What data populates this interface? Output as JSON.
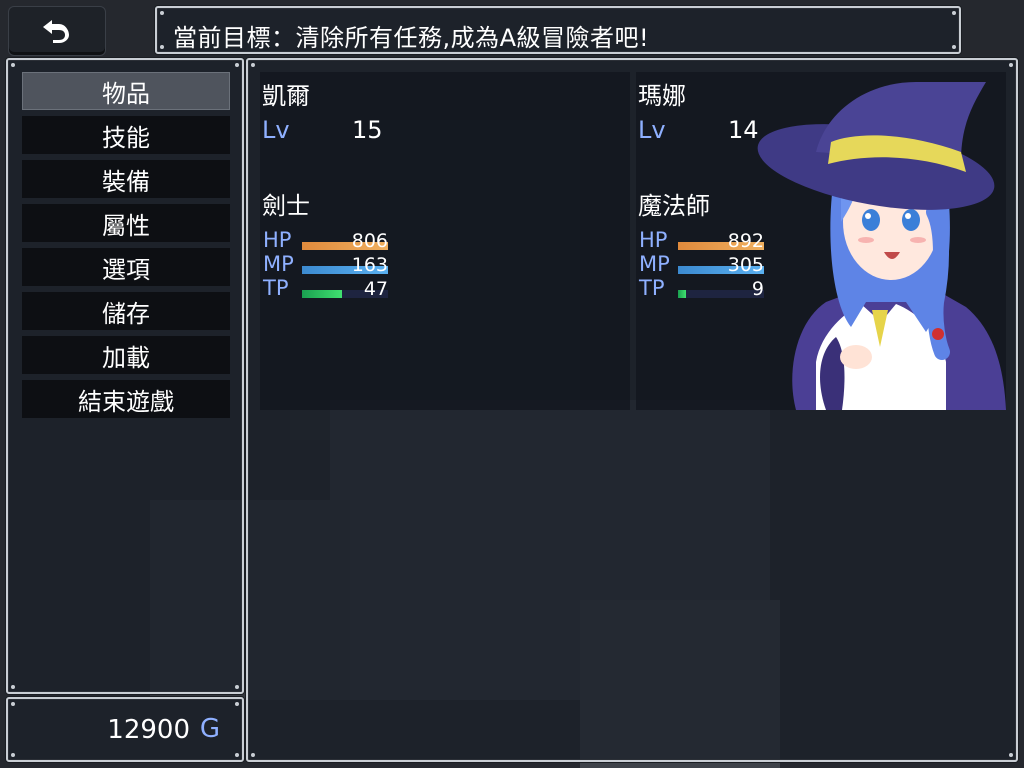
{
  "back_button": {
    "icon": "return-arrow-icon"
  },
  "objective": {
    "text": "當前目標：清除所有任務,成為A級冒險者吧!"
  },
  "menu": {
    "items": [
      "物品",
      "技能",
      "裝備",
      "屬性",
      "選項",
      "儲存",
      "加載",
      "結束遊戲"
    ],
    "selected": "物品"
  },
  "gold": {
    "value": "12900",
    "unit": "G"
  },
  "actors": [
    {
      "name": "凱爾",
      "level_label": "Lv",
      "level": "15",
      "class": "劍士",
      "hp_label": "HP",
      "hp": "806",
      "hp_ratio": 1.0,
      "mp_label": "MP",
      "mp": "163",
      "mp_ratio": 1.0,
      "tp_label": "TP",
      "tp": "47",
      "tp_ratio": 0.47
    },
    {
      "name": "瑪娜",
      "level_label": "Lv",
      "level": "14",
      "class": "魔法師",
      "hp_label": "HP",
      "hp": "892",
      "hp_ratio": 1.0,
      "mp_label": "MP",
      "mp": "305",
      "mp_ratio": 1.0,
      "tp_label": "TP",
      "tp": "9",
      "tp_ratio": 0.09
    }
  ],
  "colors": {
    "hp_gauge": [
      "#e08a3c",
      "#f0b060"
    ],
    "mp_gauge": [
      "#3c8ad0",
      "#5ab0f0"
    ],
    "tp_gauge": [
      "#1aa050",
      "#40e070"
    ],
    "system_blue": "#8fb0ff"
  }
}
